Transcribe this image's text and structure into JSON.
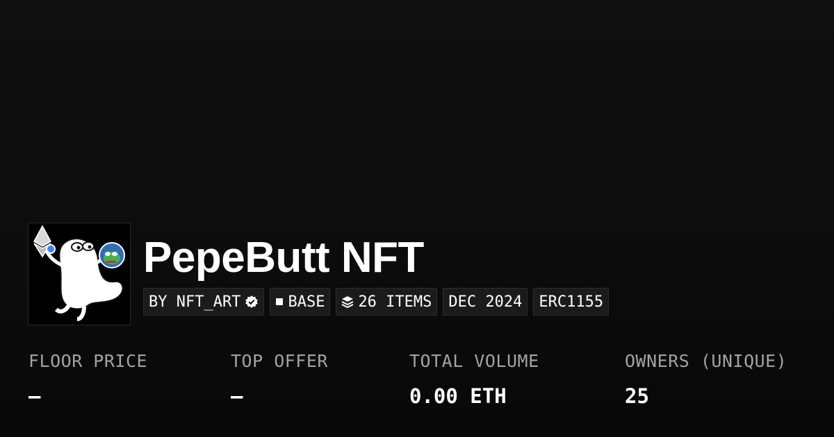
{
  "collection": {
    "name": "PepeButt NFT",
    "avatar_icon": "pepebutt-avatar-icon"
  },
  "chips": {
    "creator": "BY NFT_ART",
    "creator_icon": "verified-badge-icon",
    "chain": "BASE",
    "chain_icon": "base-square-icon",
    "items": "26 ITEMS",
    "items_icon": "layers-icon",
    "date": "DEC 2024",
    "standard": "ERC1155"
  },
  "stats": [
    {
      "label": "FLOOR PRICE",
      "value": "–"
    },
    {
      "label": "TOP OFFER",
      "value": "–"
    },
    {
      "label": "TOTAL VOLUME",
      "value": "0.00 ETH"
    },
    {
      "label": "OWNERS (UNIQUE)",
      "value": "25"
    }
  ],
  "colors": {
    "background": "#0d0d0d",
    "text": "#ffffff",
    "muted_label": "#a3a3a3",
    "chip_background": "#1b1b1b"
  }
}
